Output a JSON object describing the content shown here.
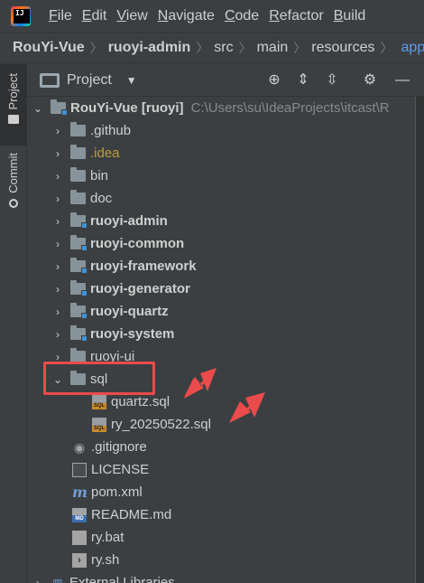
{
  "menu": {
    "items": [
      {
        "label": "File",
        "mnemonic": "F",
        "rest": "ile"
      },
      {
        "label": "Edit",
        "mnemonic": "E",
        "rest": "dit"
      },
      {
        "label": "View",
        "mnemonic": "V",
        "rest": "iew"
      },
      {
        "label": "Navigate",
        "mnemonic": "N",
        "rest": "avigate"
      },
      {
        "label": "Code",
        "mnemonic": "C",
        "rest": "ode"
      },
      {
        "label": "Refactor",
        "mnemonic": "R",
        "rest": "efactor"
      },
      {
        "label": "Build",
        "mnemonic": "B",
        "rest": "uild"
      }
    ]
  },
  "breadcrumb": {
    "items": [
      "RouYi-Vue",
      "ruoyi-admin",
      "src",
      "main",
      "resources"
    ],
    "last": "applic"
  },
  "tool_stripe": {
    "project_tab": "Project",
    "commit_tab": "Commit"
  },
  "panel": {
    "title": "Project",
    "caret": "▼"
  },
  "tree": {
    "root": {
      "label": "RouYi-Vue [ruoyi]",
      "path": "C:\\Users\\su\\IdeaProjects\\itcast\\R"
    },
    "folders": [
      {
        "label": ".github"
      },
      {
        "label": ".idea"
      },
      {
        "label": "bin"
      },
      {
        "label": "doc"
      },
      {
        "label": "ruoyi-admin"
      },
      {
        "label": "ruoyi-common"
      },
      {
        "label": "ruoyi-framework"
      },
      {
        "label": "ruoyi-generator"
      },
      {
        "label": "ruoyi-quartz"
      },
      {
        "label": "ruoyi-system"
      },
      {
        "label": "ruoyi-ui"
      }
    ],
    "sql_folder": {
      "label": "sql"
    },
    "sql_files": [
      {
        "label": "quartz.sql"
      },
      {
        "label": "ry_20250522.sql"
      }
    ],
    "files": [
      {
        "label": ".gitignore"
      },
      {
        "label": "LICENSE"
      },
      {
        "label": "pom.xml"
      },
      {
        "label": "README.md"
      },
      {
        "label": "ry.bat"
      },
      {
        "label": "ry.sh"
      }
    ],
    "external": {
      "label": "External Libraries"
    }
  },
  "icons": {
    "sql_badge": "SQL",
    "md_badge": "MD",
    "maven": "m"
  },
  "colors": {
    "annotation": "#ec4b4b",
    "idea_folder_text": "#bd9e3a",
    "breadcrumb_link": "#589df6"
  }
}
